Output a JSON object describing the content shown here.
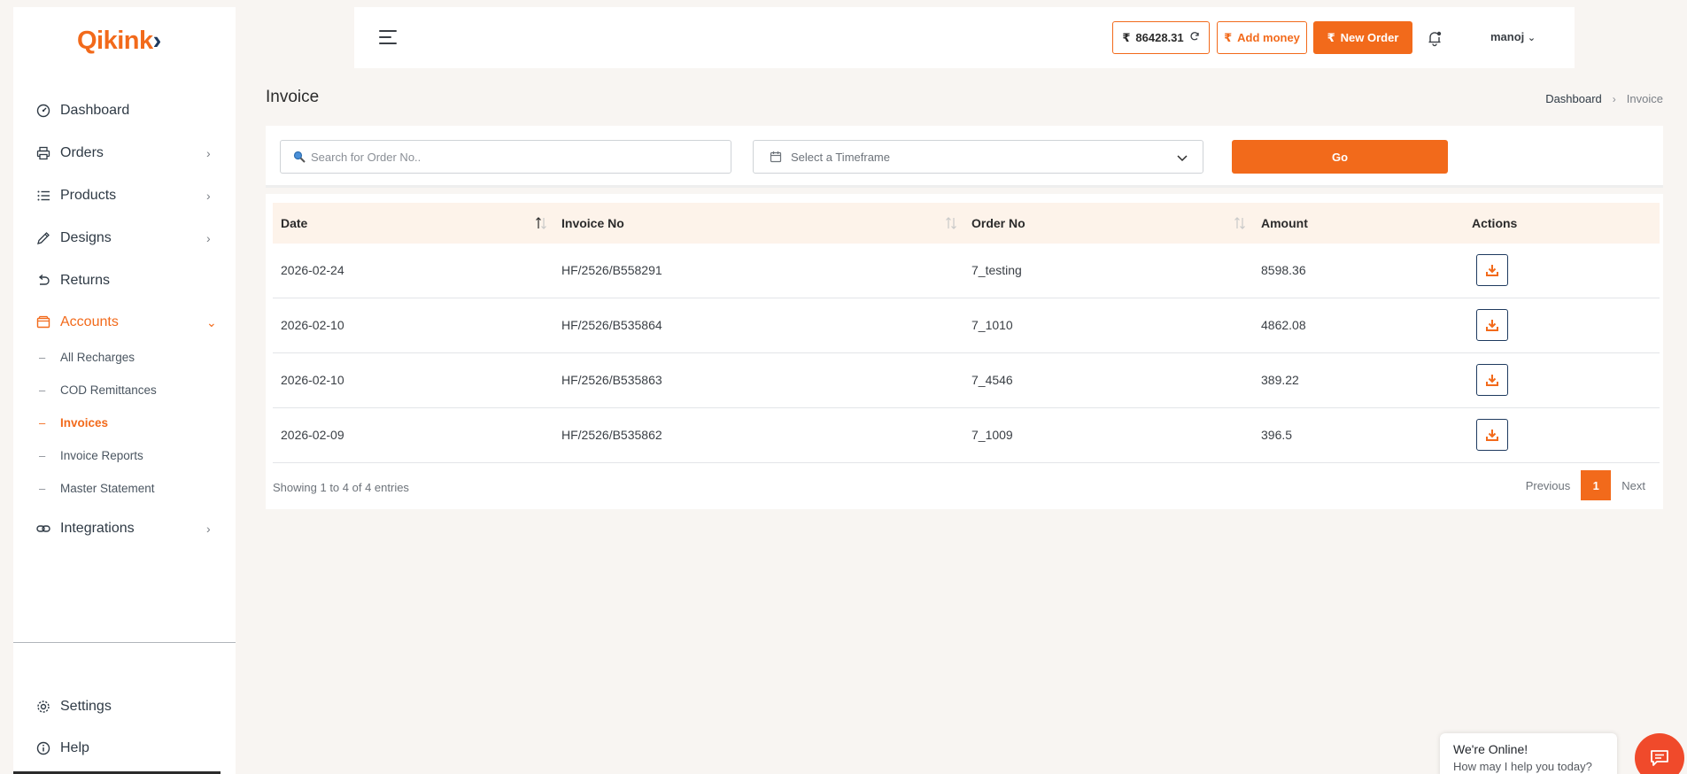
{
  "brand": {
    "logo_text": "Qikink",
    "logo_arrow": "›"
  },
  "sidebar": {
    "items": [
      {
        "label": "Dashboard",
        "icon": "dashboard-icon"
      },
      {
        "label": "Orders",
        "icon": "printer-icon",
        "expandable": true
      },
      {
        "label": "Products",
        "icon": "list-icon",
        "expandable": true
      },
      {
        "label": "Designs",
        "icon": "pencil-icon",
        "expandable": true
      },
      {
        "label": "Returns",
        "icon": "undo-icon"
      },
      {
        "label": "Accounts",
        "icon": "wallet-icon",
        "expanded": true,
        "active": true
      },
      {
        "label": "Integrations",
        "icon": "link-icon",
        "expandable": true
      }
    ],
    "accounts_sub": [
      {
        "label": "All Recharges"
      },
      {
        "label": "COD Remittances"
      },
      {
        "label": "Invoices",
        "active": true
      },
      {
        "label": "Invoice Reports"
      },
      {
        "label": "Master Statement"
      }
    ],
    "bottom": [
      {
        "label": "Settings",
        "icon": "gear-icon"
      },
      {
        "label": "Help",
        "icon": "info-icon"
      }
    ]
  },
  "topbar": {
    "currency": "₹",
    "balance": "86428.31",
    "add_money": "Add money",
    "new_order": "New Order",
    "user": "manoj"
  },
  "page": {
    "title": "Invoice",
    "breadcrumb": [
      "Dashboard",
      "Invoice"
    ]
  },
  "filters": {
    "search_placeholder": "Search for Order No..",
    "timeframe_placeholder": "Select a Timeframe",
    "go_label": "Go"
  },
  "table": {
    "columns": [
      "Date",
      "Invoice No",
      "Order No",
      "Amount",
      "Actions"
    ],
    "rows": [
      {
        "date": "2026-02-24",
        "invoice_no": "HF/2526/B558291",
        "order_no": "7_testing",
        "amount": "8598.36"
      },
      {
        "date": "2026-02-10",
        "invoice_no": "HF/2526/B535864",
        "order_no": "7_1010",
        "amount": "4862.08"
      },
      {
        "date": "2026-02-10",
        "invoice_no": "HF/2526/B535863",
        "order_no": "7_4546",
        "amount": "389.22"
      },
      {
        "date": "2026-02-09",
        "invoice_no": "HF/2526/B535862",
        "order_no": "7_1009",
        "amount": "396.5"
      }
    ],
    "showing": "Showing 1 to 4 of 4 entries",
    "pagination": {
      "previous": "Previous",
      "current": "1",
      "next": "Next"
    }
  },
  "chat": {
    "title": "We're Online!",
    "subtitle": "How may I help you today?"
  },
  "colors": {
    "accent": "#f26a1b",
    "navy": "#1e3a5f"
  }
}
